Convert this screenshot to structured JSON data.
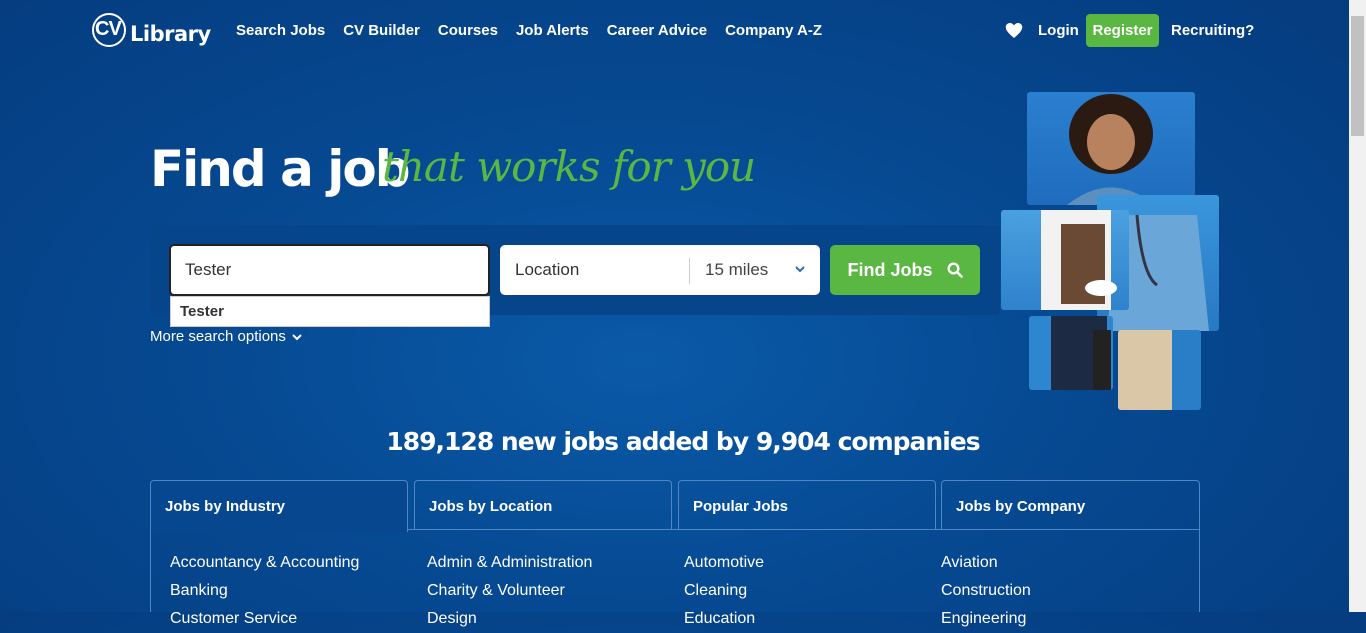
{
  "header": {
    "logo": "CV Library",
    "nav": [
      "Search Jobs",
      "CV Builder",
      "Courses",
      "Job Alerts",
      "Career Advice",
      "Company A-Z"
    ],
    "login": "Login",
    "register": "Register",
    "recruiting": "Recruiting?"
  },
  "hero": {
    "title": "Find a job",
    "script": "that works for you"
  },
  "search": {
    "keyword_value": "Tester",
    "location_placeholder": "Location",
    "radius": "15 miles",
    "button": "Find Jobs",
    "suggestion": "Tester",
    "more_options": "More search options"
  },
  "stats": "189,128 new jobs added by 9,904 companies",
  "tabs": [
    "Jobs by Industry",
    "Jobs by Location",
    "Popular Jobs",
    "Jobs by Company"
  ],
  "columns": [
    [
      "Accountancy & Accounting",
      "Banking",
      "Customer Service"
    ],
    [
      "Admin & Administration",
      "Charity & Volunteer",
      "Design"
    ],
    [
      "Automotive",
      "Cleaning",
      "Education"
    ],
    [
      "Aviation",
      "Construction",
      "Engineering"
    ]
  ],
  "colors": {
    "brand_blue": "#064a93",
    "accent_green": "#5ab741"
  }
}
